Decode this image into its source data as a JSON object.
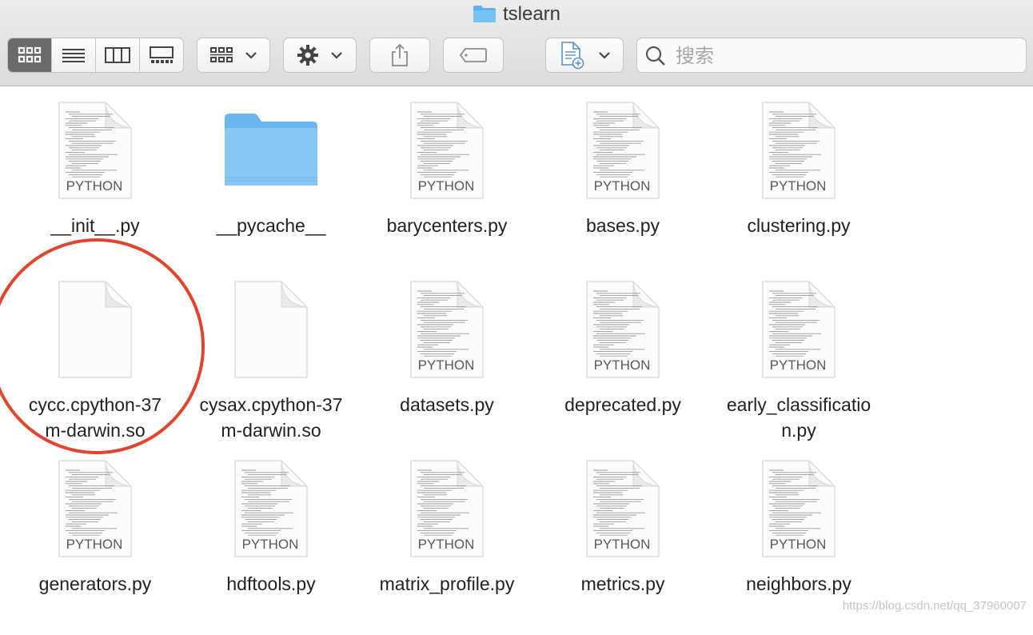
{
  "window": {
    "title": "tslearn"
  },
  "toolbar": {
    "view_modes": [
      "icon-view",
      "list-view",
      "column-view",
      "gallery-view"
    ],
    "active_view": "icon-view",
    "search_placeholder": "搜索"
  },
  "files": [
    {
      "name": "__init__.py",
      "kind": "PYTHON",
      "type": "python"
    },
    {
      "name": "__pycache__",
      "kind": "",
      "type": "folder"
    },
    {
      "name": "barycenters.py",
      "kind": "PYTHON",
      "type": "python"
    },
    {
      "name": "bases.py",
      "kind": "PYTHON",
      "type": "python"
    },
    {
      "name": "clustering.py",
      "kind": "PYTHON",
      "type": "python"
    },
    {
      "name_line1": "cycc.cpython-37",
      "name_line2": "m-darwin.so",
      "type": "blank"
    },
    {
      "name_line1": "cysax.cpython-37",
      "name_line2": "m-darwin.so",
      "type": "blank"
    },
    {
      "name": "datasets.py",
      "kind": "PYTHON",
      "type": "python"
    },
    {
      "name": "deprecated.py",
      "kind": "PYTHON",
      "type": "python"
    },
    {
      "name_line1": "early_classificatio",
      "name_line2": "n.py",
      "kind": "PYTHON",
      "type": "python"
    },
    {
      "name": "generators.py",
      "kind": "PYTHON",
      "type": "python"
    },
    {
      "name": "hdftools.py",
      "kind": "PYTHON",
      "type": "python"
    },
    {
      "name": "matrix_profile.py",
      "kind": "PYTHON",
      "type": "python"
    },
    {
      "name": "metrics.py",
      "kind": "PYTHON",
      "type": "python"
    },
    {
      "name": "neighbors.py",
      "kind": "PYTHON",
      "type": "python"
    }
  ],
  "annotation": {
    "color": "#e0452e"
  },
  "watermark": "https://blog.csdn.net/qq_37960007"
}
